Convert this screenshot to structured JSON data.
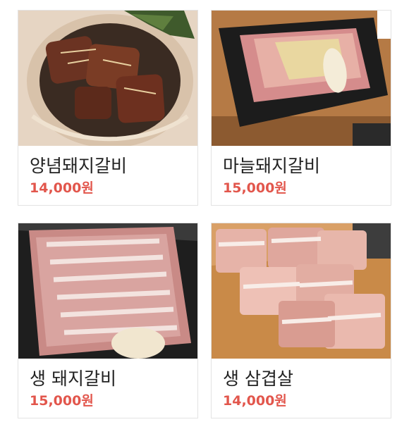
{
  "menu_items": [
    {
      "name": "양념돼지갈비",
      "price": "14,000원",
      "photo": "marinated-pork-ribs-photo"
    },
    {
      "name": "마늘돼지갈비",
      "price": "15,000원",
      "photo": "garlic-pork-ribs-photo"
    },
    {
      "name": "생 돼지갈비",
      "price": "15,000원",
      "photo": "fresh-pork-ribs-photo"
    },
    {
      "name": "생 삼겹살",
      "price": "14,000원",
      "photo": "fresh-pork-belly-photo"
    }
  ],
  "colors": {
    "price": "#e2564c",
    "name": "#222222",
    "card_border": "#e3e3e3"
  }
}
